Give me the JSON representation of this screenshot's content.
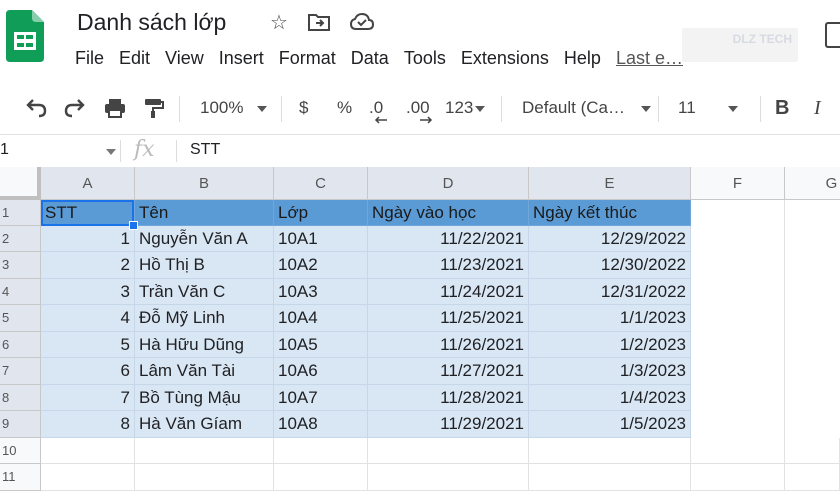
{
  "app": {
    "title": "Danh sách lớp",
    "menu": [
      "File",
      "Edit",
      "View",
      "Insert",
      "Format",
      "Data",
      "Tools",
      "Extensions",
      "Help"
    ],
    "last_edit": "Last e…",
    "watermark": "DLZ TECH",
    "colors": {
      "logo_green": "#0f9d58",
      "header_fill": "#5b9bd5",
      "data_fill": "#d9e6f4",
      "selection": "#1a73e8"
    }
  },
  "toolbar": {
    "zoom": "100%",
    "currency": "$",
    "percent": "%",
    "dec_decrease": ".0",
    "dec_increase": ".00",
    "more_formats": "123",
    "font": "Default (Ca…",
    "font_size": "11",
    "bold": "B",
    "italic": "I",
    "icons": [
      "undo-icon",
      "redo-icon",
      "print-icon",
      "paint-format-icon"
    ]
  },
  "formula_bar": {
    "name_box": "1",
    "fx": "fx",
    "value": "STT"
  },
  "sheet": {
    "columns": [
      "A",
      "B",
      "C",
      "D",
      "E",
      "F",
      "G"
    ],
    "rows": [
      "1",
      "2",
      "3",
      "4",
      "5",
      "6",
      "7",
      "8",
      "9",
      "10",
      "11"
    ],
    "headers": [
      "STT",
      "Tên",
      "Lớp",
      "Ngày vào học",
      "Ngày kết thúc"
    ],
    "data": [
      [
        "1",
        "Nguyễn Văn A",
        "10A1",
        "11/22/2021",
        "12/29/2022"
      ],
      [
        "2",
        "Hồ Thị B",
        "10A2",
        "11/23/2021",
        "12/30/2022"
      ],
      [
        "3",
        "Trần Văn C",
        "10A3",
        "11/24/2021",
        "12/31/2022"
      ],
      [
        "4",
        "Đỗ Mỹ Linh",
        "10A4",
        "11/25/2021",
        "1/1/2023"
      ],
      [
        "5",
        "Hà Hữu Dũng",
        "10A5",
        "11/26/2021",
        "1/2/2023"
      ],
      [
        "6",
        "Lâm Văn Tài",
        "10A6",
        "11/27/2021",
        "1/3/2023"
      ],
      [
        "7",
        "Bồ Tùng Mậu",
        "10A7",
        "11/28/2021",
        "1/4/2023"
      ],
      [
        "8",
        "Hà Văn Gíam",
        "10A8",
        "11/29/2021",
        "1/5/2023"
      ]
    ]
  }
}
